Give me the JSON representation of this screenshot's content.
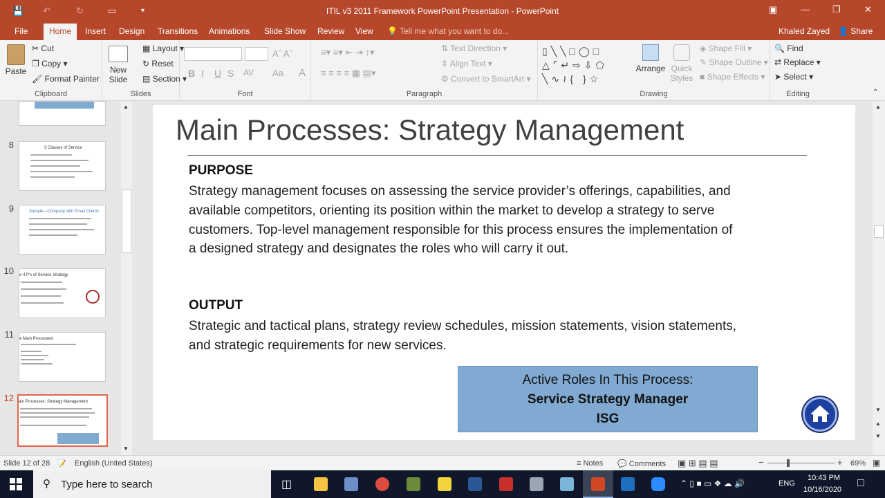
{
  "window": {
    "title": "ITIL v3 2011 Framework PowerPoint Presentation - PowerPoint",
    "user": "Khaled Zayed",
    "share_label": "Share"
  },
  "tabs": [
    {
      "label": "File"
    },
    {
      "label": "Home"
    },
    {
      "label": "Insert"
    },
    {
      "label": "Design"
    },
    {
      "label": "Transitions"
    },
    {
      "label": "Animations"
    },
    {
      "label": "Slide Show"
    },
    {
      "label": "Review"
    },
    {
      "label": "View"
    }
  ],
  "tellme": "Tell me what you want to do...",
  "ribbon": {
    "clipboard": {
      "paste": "Paste",
      "cut": "Cut",
      "copy": "Copy",
      "format_painter": "Format Painter",
      "label": "Clipboard"
    },
    "slides": {
      "new_slide": "New Slide",
      "layout": "Layout",
      "reset": "Reset",
      "section": "Section",
      "label": "Slides"
    },
    "font": {
      "label": "Font",
      "bold": "B",
      "italic": "I",
      "underline": "U",
      "shadow": "S",
      "spacing": "AV",
      "case": "Aa",
      "color": "A"
    },
    "paragraph": {
      "text_direction": "Text Direction",
      "align_text": "Align Text",
      "convert_smartart": "Convert to SmartArt",
      "label": "Paragraph"
    },
    "drawing": {
      "arrange": "Arrange",
      "quick_styles": "Quick Styles",
      "shape_fill": "Shape Fill",
      "shape_outline": "Shape Outline",
      "shape_effects": "Shape Effects",
      "label": "Drawing"
    },
    "editing": {
      "find": "Find",
      "replace": "Replace",
      "select": "Select",
      "label": "Editing"
    }
  },
  "thumbnails": [
    {
      "num": "8",
      "title": "3 Classes of Service"
    },
    {
      "num": "9",
      "title": "Sample—Company with Email Clients"
    },
    {
      "num": "10",
      "title": "e 4 P's of Service Strategy"
    },
    {
      "num": "11",
      "title": "e Main Processes!"
    },
    {
      "num": "12",
      "title": "ain Processes: Strategy Management"
    }
  ],
  "slide": {
    "title": "Main Processes: Strategy Management",
    "purpose_heading": "PURPOSE",
    "purpose_text": "Strategy management focuses on assessing the service provider’s offerings, capabilities, and available competitors, orienting its position within the market to develop a strategy to serve customers. Top-level management responsible for this process ensures the implementation of a designed strategy and designates the roles who will carry it out.",
    "output_heading": "OUTPUT",
    "output_text": "Strategic and tactical plans, strategy review schedules, mission statements, vision statements, and strategic requirements for new services.",
    "roles_label": "Active Roles In This Process:",
    "roles_primary": "Service Strategy Manager",
    "roles_secondary": "ISG"
  },
  "status": {
    "slide_count": "Slide 12 of 28",
    "language": "English (United States)",
    "notes": "Notes",
    "comments": "Comments",
    "zoom": "69%"
  },
  "taskbar": {
    "search_placeholder": "Type here to search",
    "lang": "ENG",
    "time": "10:43 PM",
    "date": "10/16/2020"
  },
  "colors": {
    "accent": "#b7472a",
    "roles_box": "#80aad2",
    "home_button": "#1c3fa0"
  }
}
